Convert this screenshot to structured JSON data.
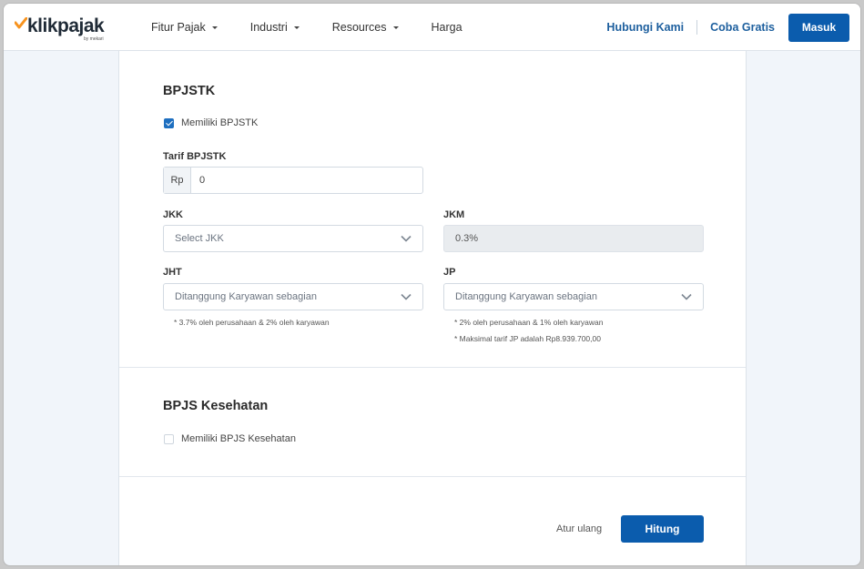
{
  "navbar": {
    "logo_text": "klikpajak",
    "logo_sub": "by mekari",
    "menu": [
      {
        "label": "Fitur Pajak",
        "has_dropdown": true
      },
      {
        "label": "Industri",
        "has_dropdown": true
      },
      {
        "label": "Resources",
        "has_dropdown": true
      },
      {
        "label": "Harga",
        "has_dropdown": false
      }
    ],
    "contact_label": "Hubungi Kami",
    "trial_label": "Coba Gratis",
    "login_label": "Masuk"
  },
  "bpjstk": {
    "title": "BPJSTK",
    "checkbox_label": "Memiliki BPJSTK",
    "checkbox_checked": true,
    "tarif_label": "Tarif BPJSTK",
    "tarif_prefix": "Rp",
    "tarif_value": "0",
    "jkk_label": "JKK",
    "jkk_placeholder": "Select JKK",
    "jkm_label": "JKM",
    "jkm_value": "0.3%",
    "jht_label": "JHT",
    "jht_value": "Ditanggung Karyawan sebagian",
    "jht_note": "* 3.7% oleh perusahaan & 2% oleh karyawan",
    "jp_label": "JP",
    "jp_value": "Ditanggung Karyawan sebagian",
    "jp_note_1": "* 2% oleh perusahaan & 1% oleh karyawan",
    "jp_note_2": "* Maksimal tarif JP adalah Rp8.939.700,00"
  },
  "bpjs_kesehatan": {
    "title": "BPJS Kesehatan",
    "checkbox_label": "Memiliki BPJS Kesehatan",
    "checkbox_checked": false
  },
  "actions": {
    "reset_label": "Atur ulang",
    "submit_label": "Hitung"
  },
  "colors": {
    "primary": "#0b5cad",
    "link": "#1d5f9e",
    "logo_check": "#f7931e"
  }
}
